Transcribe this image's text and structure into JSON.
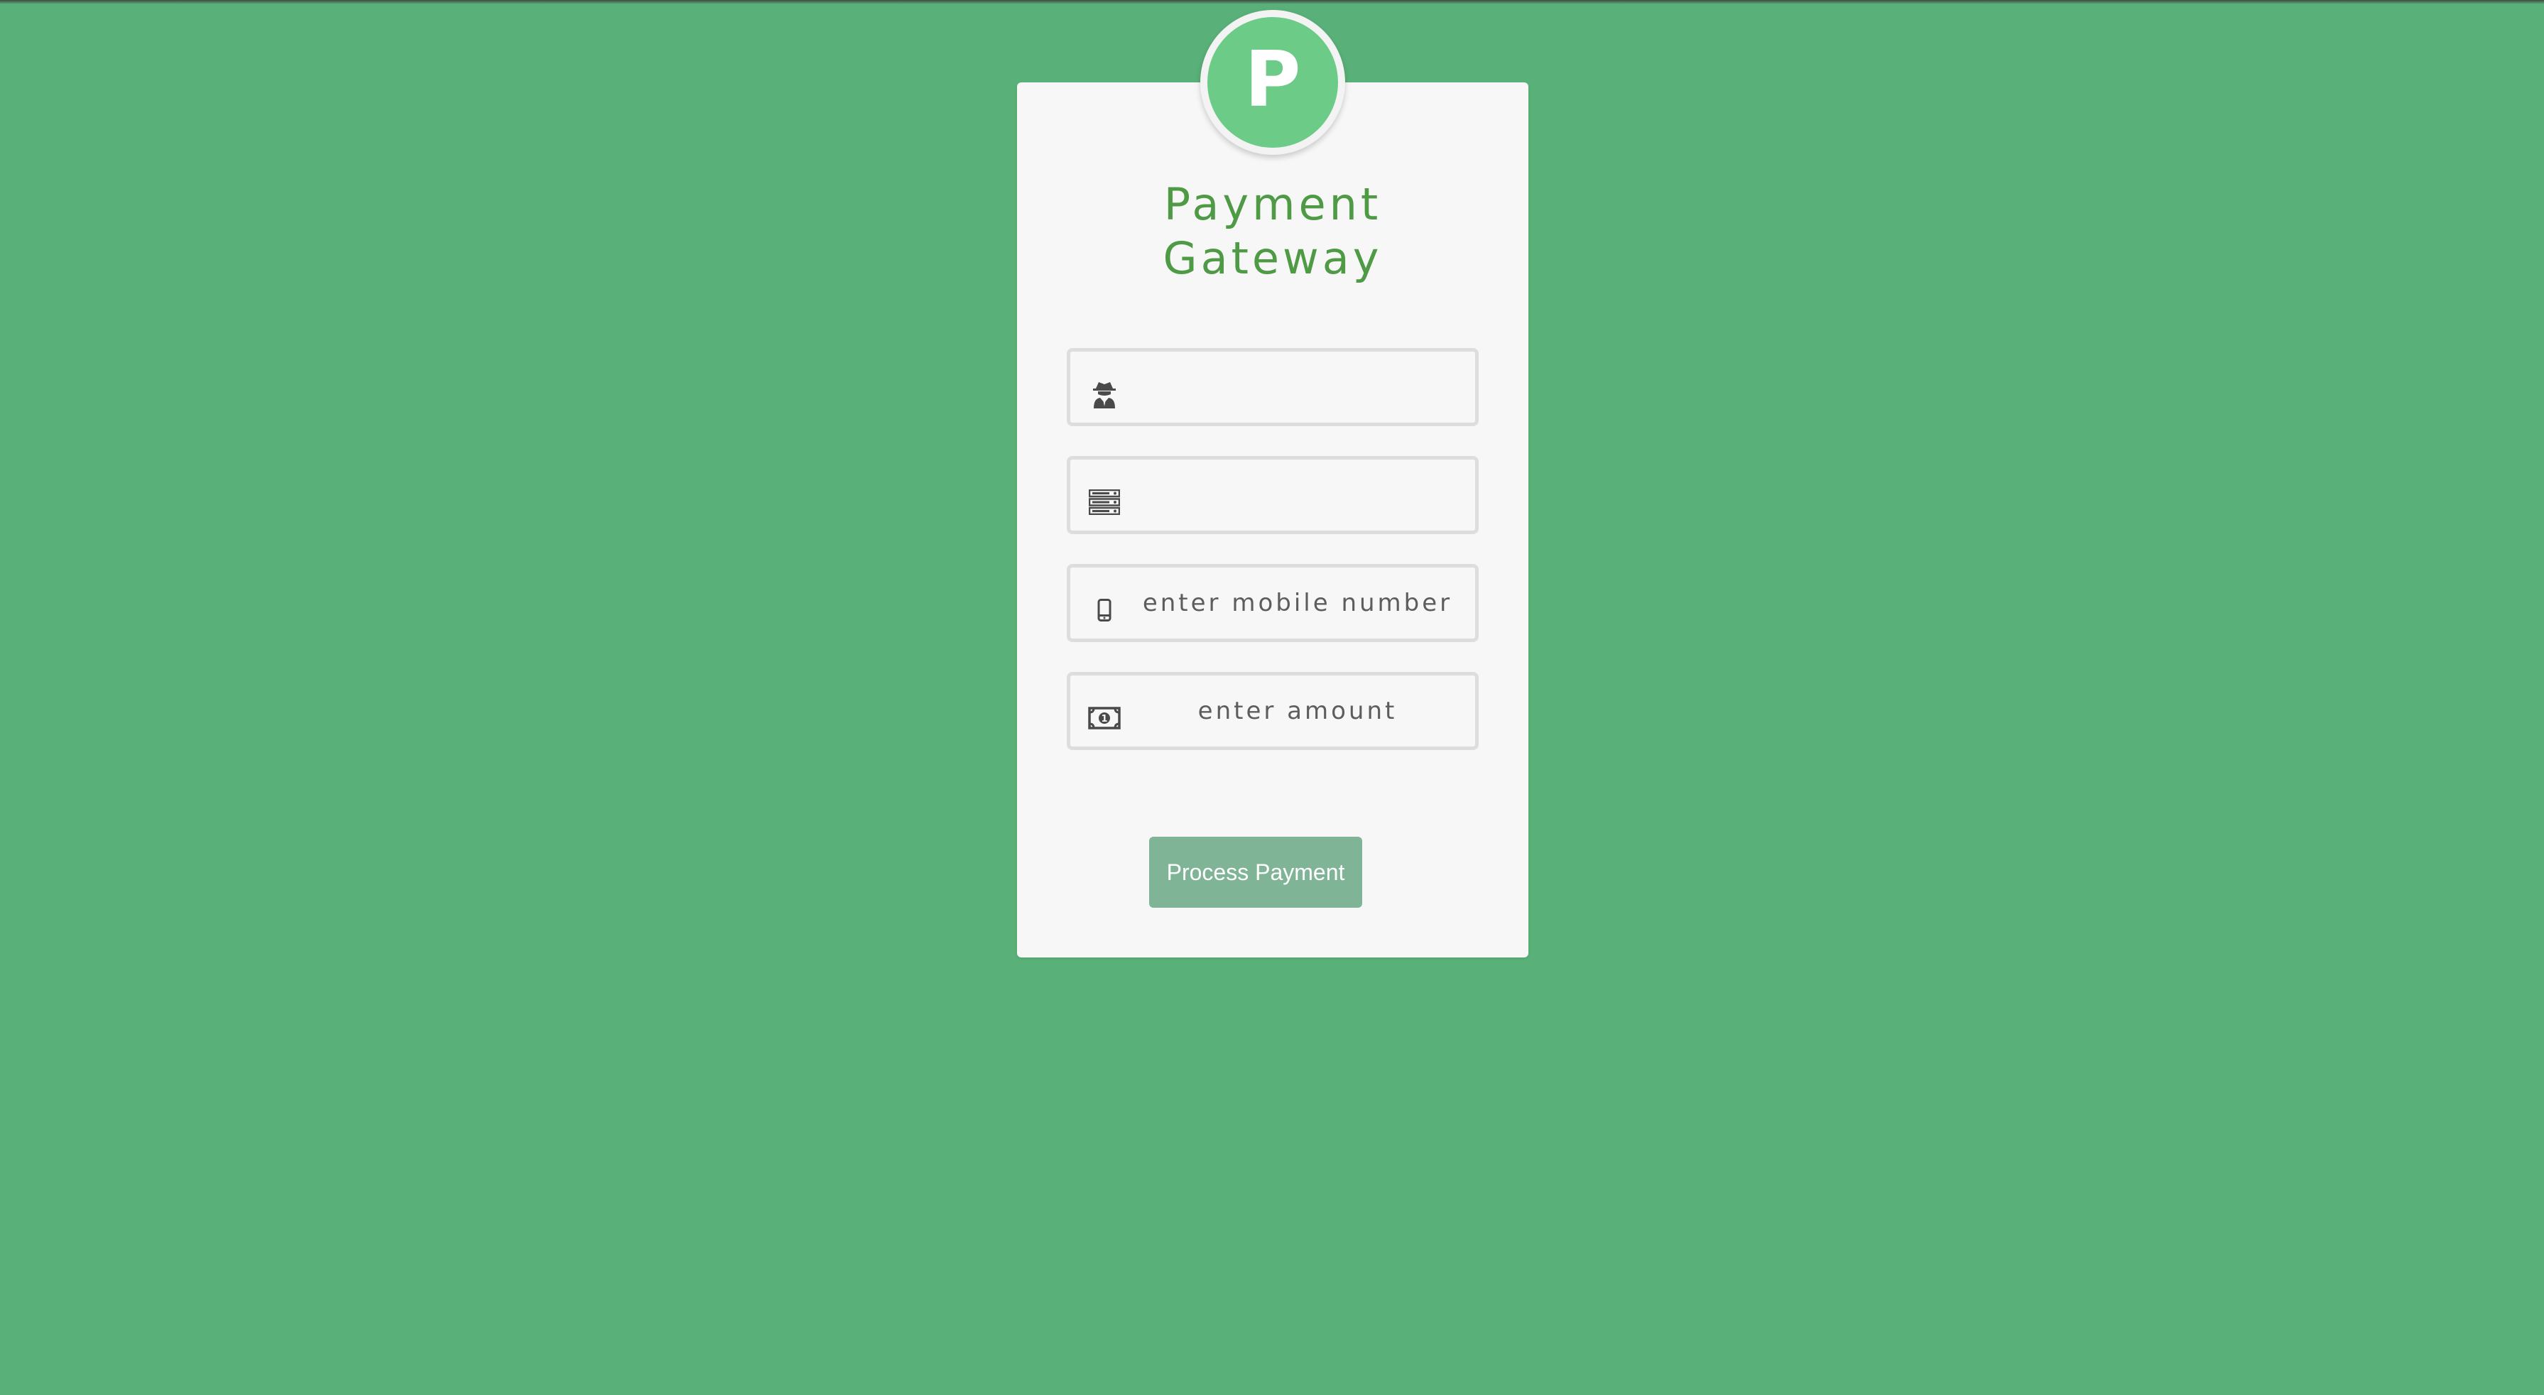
{
  "logo": {
    "letter": "P"
  },
  "header": {
    "title_line1": "Payment",
    "title_line2": "Gateway"
  },
  "form": {
    "fields": [
      {
        "icon": "user-secret-icon",
        "value": "",
        "placeholder": ""
      },
      {
        "icon": "server-icon",
        "value": "",
        "placeholder": ""
      },
      {
        "icon": "mobile-phone-icon",
        "value": "",
        "placeholder": "enter mobile number"
      },
      {
        "icon": "money-bill-icon",
        "value": "",
        "placeholder": "enter amount"
      }
    ],
    "submit_label": "Process Payment"
  },
  "colors": {
    "background": "#59b179",
    "card": "#f7f7f7",
    "title": "#4e9a45",
    "logo": "#6ccb86",
    "button": "#7fb596"
  }
}
